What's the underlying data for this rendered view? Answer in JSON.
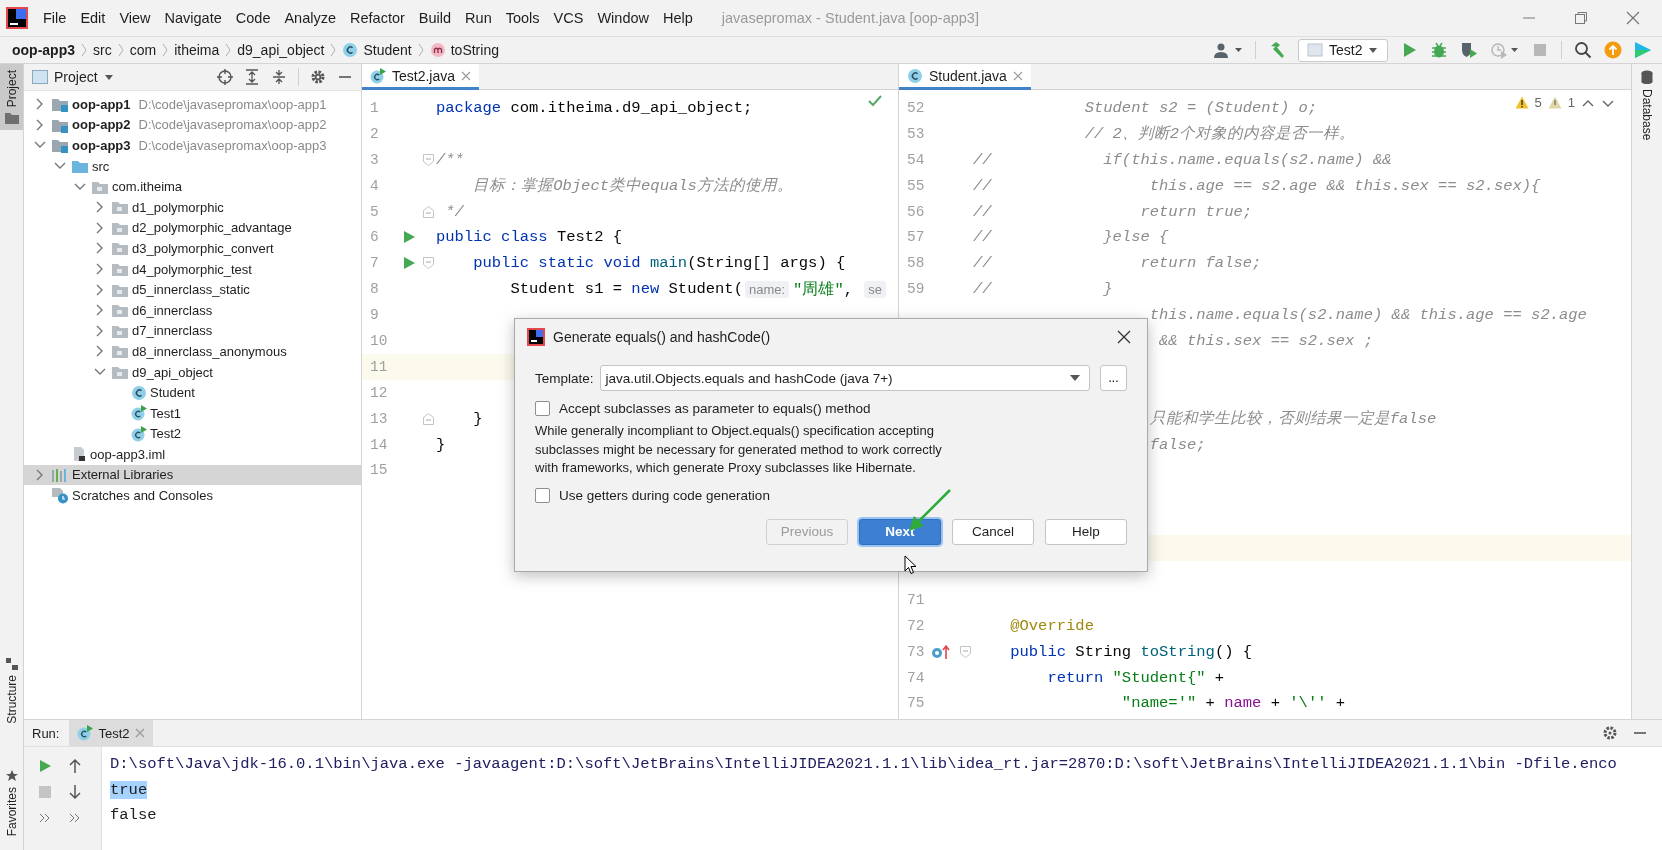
{
  "menu_bar": {
    "items": [
      "File",
      "Edit",
      "View",
      "Navigate",
      "Code",
      "Analyze",
      "Refactor",
      "Build",
      "Run",
      "Tools",
      "VCS",
      "Window",
      "Help"
    ],
    "title": "javasepromax - Student.java [oop-app3]"
  },
  "breadcrumb": [
    {
      "label": "oop-app3",
      "kind": "module"
    },
    {
      "label": "src",
      "kind": "folder"
    },
    {
      "label": "com",
      "kind": "folder"
    },
    {
      "label": "itheima",
      "kind": "folder"
    },
    {
      "label": "d9_api_object",
      "kind": "folder"
    },
    {
      "label": "Student",
      "kind": "class"
    },
    {
      "label": "toString",
      "kind": "method"
    }
  ],
  "toolbar": {
    "run_config": "Test2",
    "buttons": [
      {
        "kind": "run",
        "disabled": false
      },
      {
        "kind": "debug",
        "disabled": false
      },
      {
        "kind": "coverage",
        "disabled": false
      },
      {
        "kind": "profile",
        "disabled": true
      },
      {
        "kind": "stop",
        "disabled": true
      }
    ]
  },
  "side_stripes": {
    "left_top": [
      {
        "label": "Project",
        "selected": true
      }
    ],
    "left_bottom": [
      {
        "label": "Structure",
        "selected": false
      },
      {
        "label": "Favorites",
        "selected": false
      }
    ],
    "right": [
      {
        "label": "Database",
        "selected": false
      }
    ]
  },
  "project_panel": {
    "title": "Project",
    "tree": [
      {
        "label": "oop-app1",
        "path": "D:\\code\\javasepromax\\oop-app1",
        "kind": "module",
        "expanded": false,
        "selected": false
      },
      {
        "label": "oop-app2",
        "path": "D:\\code\\javasepromax\\oop-app2",
        "kind": "module",
        "expanded": false,
        "selected": false
      },
      {
        "label": "oop-app3",
        "path": "D:\\code\\javasepromax\\oop-app3",
        "kind": "module",
        "expanded": true,
        "selected": false,
        "children": [
          {
            "label": "src",
            "kind": "source-folder",
            "expanded": true,
            "selected": false,
            "children": [
              {
                "label": "com.itheima",
                "kind": "package",
                "expanded": true,
                "selected": false,
                "children": [
                  {
                    "label": "d1_polymorphic",
                    "kind": "package",
                    "expanded": false,
                    "selected": false
                  },
                  {
                    "label": "d2_polymorphic_advantage",
                    "kind": "package",
                    "expanded": false,
                    "selected": false
                  },
                  {
                    "label": "d3_polymorphic_convert",
                    "kind": "package",
                    "expanded": false,
                    "selected": false
                  },
                  {
                    "label": "d4_polymorphic_test",
                    "kind": "package",
                    "expanded": false,
                    "selected": false
                  },
                  {
                    "label": "d5_innerclass_static",
                    "kind": "package",
                    "expanded": false,
                    "selected": false
                  },
                  {
                    "label": "d6_innerclass",
                    "kind": "package",
                    "expanded": false,
                    "selected": false
                  },
                  {
                    "label": "d7_innerclass",
                    "kind": "package",
                    "expanded": false,
                    "selected": false
                  },
                  {
                    "label": "d8_innerclass_anonymous",
                    "kind": "package",
                    "expanded": false,
                    "selected": false
                  },
                  {
                    "label": "d9_api_object",
                    "kind": "package",
                    "expanded": true,
                    "selected": false,
                    "children": [
                      {
                        "label": "Student",
                        "kind": "class",
                        "selected": false
                      },
                      {
                        "label": "Test1",
                        "kind": "runnable-class",
                        "selected": false
                      },
                      {
                        "label": "Test2",
                        "kind": "runnable-class",
                        "selected": false
                      }
                    ]
                  }
                ]
              }
            ]
          },
          {
            "label": "oop-app3.iml",
            "kind": "iml-file",
            "selected": false
          }
        ]
      },
      {
        "label": "External Libraries",
        "kind": "libraries",
        "expanded": false,
        "selected": true
      },
      {
        "label": "Scratches and Consoles",
        "kind": "scratches",
        "selected": false
      }
    ]
  },
  "editors": [
    {
      "tab": {
        "label": "Test2.java",
        "kind": "runnable-class",
        "selected": true
      },
      "status": {
        "kind": "ok"
      },
      "lines": [
        {
          "n": "1",
          "current": false,
          "tokens": [
            {
              "kind": "kw",
              "text": "package"
            },
            {
              "kind": "plain",
              "text": " com.itheima.d9_api_object;"
            }
          ]
        },
        {
          "n": "2",
          "current": false
        },
        {
          "n": "3",
          "current": false,
          "markers": [
            {
              "kind": "fold-start"
            }
          ],
          "tokens": [
            {
              "kind": "comment",
              "text": "/**"
            }
          ]
        },
        {
          "n": "4",
          "current": false,
          "tokens": [
            {
              "kind": "comment",
              "text": "    目标：掌握Object类中equals方法的使用。"
            }
          ]
        },
        {
          "n": "5",
          "current": false,
          "markers": [
            {
              "kind": "fold-end"
            }
          ],
          "tokens": [
            {
              "kind": "comment",
              "text": " */"
            }
          ]
        },
        {
          "n": "6",
          "current": false,
          "markers": [
            {
              "kind": "run"
            }
          ],
          "tokens": [
            {
              "kind": "kw",
              "text": "public class"
            },
            {
              "kind": "plain",
              "text": " Test2 {"
            }
          ]
        },
        {
          "n": "7",
          "current": false,
          "markers": [
            {
              "kind": "run"
            },
            {
              "kind": "fold-start"
            }
          ],
          "tokens": [
            {
              "kind": "kw",
              "text": "    public static void"
            },
            {
              "kind": "method",
              "text": " main"
            },
            {
              "kind": "plain",
              "text": "(String[] args) {"
            }
          ]
        },
        {
          "n": "8",
          "current": false,
          "tokens": [
            {
              "kind": "plain",
              "text": "        Student s1 = "
            },
            {
              "kind": "kw",
              "text": "new"
            },
            {
              "kind": "plain",
              "text": " Student("
            },
            {
              "kind": "hint",
              "text": "name:"
            },
            {
              "kind": "str",
              "text": "\"周雄\""
            },
            {
              "kind": "plain",
              "text": ", "
            },
            {
              "kind": "hint",
              "text": "se"
            }
          ]
        },
        {
          "n": "9",
          "current": false
        },
        {
          "n": "10",
          "current": false
        },
        {
          "n": "11",
          "current": true
        },
        {
          "n": "12",
          "current": false
        },
        {
          "n": "13",
          "current": false,
          "markers": [
            {
              "kind": "fold-end"
            }
          ],
          "tokens": [
            {
              "kind": "plain",
              "text": "    }"
            }
          ]
        },
        {
          "n": "14",
          "current": false,
          "tokens": [
            {
              "kind": "plain",
              "text": "}"
            }
          ]
        },
        {
          "n": "15",
          "current": false
        }
      ]
    },
    {
      "tab": {
        "label": "Student.java",
        "kind": "class",
        "selected": true
      },
      "status": {
        "kind": "warnings",
        "warnings": "5",
        "weak_warnings": "1"
      },
      "lines": [
        {
          "n": "52",
          "current": false,
          "tokens": [
            {
              "kind": "comment",
              "text": "            Student s2 = (Student) o;"
            }
          ]
        },
        {
          "n": "53",
          "current": false,
          "tokens": [
            {
              "kind": "comment",
              "text": "            // 2、判断2个对象的内容是否一样。"
            }
          ]
        },
        {
          "n": "54",
          "current": false,
          "tokens": [
            {
              "kind": "comment",
              "text": "//            if(this.name.equals(s2.name) &&"
            }
          ]
        },
        {
          "n": "55",
          "current": false,
          "tokens": [
            {
              "kind": "comment",
              "text": "//                 this.age == s2.age && this.sex == s2.sex){"
            }
          ]
        },
        {
          "n": "56",
          "current": false,
          "tokens": [
            {
              "kind": "comment",
              "text": "//                return true;"
            }
          ]
        },
        {
          "n": "57",
          "current": false,
          "tokens": [
            {
              "kind": "comment",
              "text": "//            }else {"
            }
          ]
        },
        {
          "n": "58",
          "current": false,
          "tokens": [
            {
              "kind": "comment",
              "text": "//                return false;"
            }
          ]
        },
        {
          "n": "59",
          "current": false,
          "tokens": [
            {
              "kind": "comment",
              "text": "//            }"
            }
          ]
        },
        {
          "current": false,
          "tokens": [
            {
              "kind": "comment",
              "text": "                   this.name.equals(s2.name) && this.age == s2.age"
            }
          ]
        },
        {
          "current": false,
          "tokens": [
            {
              "kind": "comment",
              "text": "                    && this.sex == s2.sex ;"
            }
          ]
        },
        {
          "current": false
        },
        {
          "current": false
        },
        {
          "current": false,
          "tokens": [
            {
              "kind": "comment",
              "text": "                   只能和学生比较，否则结果一定是false"
            }
          ]
        },
        {
          "current": false,
          "tokens": [
            {
              "kind": "comment",
              "text": "                   false;"
            }
          ]
        },
        {
          "current": false
        },
        {
          "current": false
        },
        {
          "current": false
        },
        {
          "current": true
        },
        {
          "current": false
        },
        {
          "n": "71",
          "current": false
        },
        {
          "n": "72",
          "current": false,
          "tokens": [
            {
              "kind": "annot",
              "text": "    @Override"
            }
          ]
        },
        {
          "n": "73",
          "current": false,
          "markers": [
            {
              "kind": "override"
            },
            {
              "kind": "fold-start"
            }
          ],
          "tokens": [
            {
              "kind": "kw",
              "text": "    public"
            },
            {
              "kind": "plain",
              "text": " String "
            },
            {
              "kind": "method",
              "text": "toString"
            },
            {
              "kind": "plain",
              "text": "() {"
            }
          ]
        },
        {
          "n": "74",
          "current": false,
          "tokens": [
            {
              "kind": "kw",
              "text": "        return"
            },
            {
              "kind": "str",
              "text": " \"Student{\""
            },
            {
              "kind": "plain",
              "text": " +"
            }
          ]
        },
        {
          "n": "75",
          "current": false,
          "tokens": [
            {
              "kind": "str",
              "text": "                \"name='\""
            },
            {
              "kind": "plain",
              "text": " + "
            },
            {
              "kind": "field",
              "text": "name"
            },
            {
              "kind": "plain",
              "text": " + "
            },
            {
              "kind": "str",
              "text": "'\\''"
            },
            {
              "kind": "plain",
              "text": " +"
            }
          ]
        }
      ]
    }
  ],
  "dialog": {
    "title": "Generate equals() and hashCode()",
    "template_label": "Template:",
    "template_value": "java.util.Objects.equals and hashCode (java 7+)",
    "more_button": "...",
    "items": [
      {
        "kind": "checkbox",
        "label": "Accept subclasses as parameter to equals() method",
        "checked": false
      },
      {
        "kind": "note",
        "text": "While generally incompliant to Object.equals() specification accepting subclasses might be necessary for generated method to work correctly with frameworks, which generate Proxy subclasses like Hibernate."
      },
      {
        "kind": "checkbox",
        "label": "Use getters during code generation",
        "checked": false
      }
    ],
    "buttons": [
      {
        "label": "Previous",
        "disabled": true,
        "default": false
      },
      {
        "label": "Next",
        "disabled": false,
        "default": true
      },
      {
        "label": "Cancel",
        "disabled": false,
        "default": false
      },
      {
        "label": "Help",
        "disabled": false,
        "default": false
      }
    ]
  },
  "run_panel": {
    "label": "Run:",
    "tab": {
      "label": "Test2",
      "selected": true
    },
    "buttons": [
      {
        "kind": "rerun",
        "disabled": false
      },
      {
        "kind": "stop",
        "disabled": true
      }
    ],
    "console": [
      {
        "kind": "command",
        "text": "D:\\soft\\Java\\jdk-16.0.1\\bin\\java.exe -javaagent:D:\\soft\\JetBrains\\IntelliJIDEA2021.1.1\\lib\\idea_rt.jar=2870:D:\\soft\\JetBrains\\IntelliJIDEA2021.1.1\\bin -Dfile.enco",
        "selected": false
      },
      {
        "kind": "output",
        "text": "true",
        "selected": true
      },
      {
        "kind": "output",
        "text": "false",
        "selected": false
      }
    ]
  }
}
